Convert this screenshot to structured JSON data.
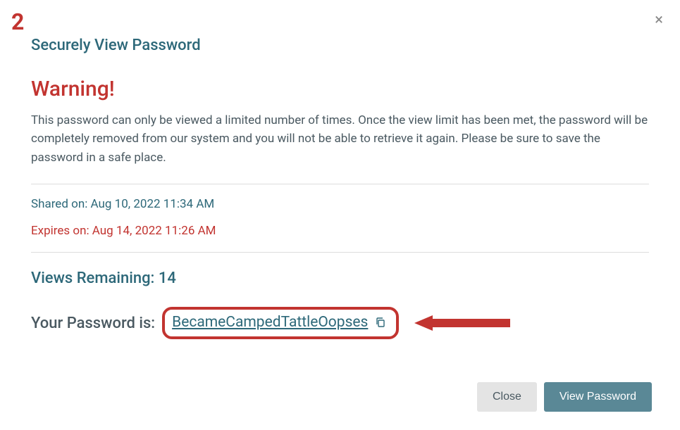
{
  "annotation": {
    "step_number": "2"
  },
  "modal": {
    "title": "Securely View Password",
    "warning_title": "Warning!",
    "warning_text": "This password can only be viewed a limited number of times. Once the view limit has been met, the password will be completely removed from our system and you will not be able to retrieve it again. Please be sure to save the password in a safe place.",
    "shared_on": "Shared on: Aug 10, 2022 11:34 AM",
    "expires_on": "Expires on: Aug 14, 2022 11:26 AM",
    "views_remaining": "Views Remaining: 14",
    "password_label": "Your Password is:",
    "password_value": "BecameCampedTattleOopses",
    "close_button": "Close",
    "view_button": "View Password"
  }
}
